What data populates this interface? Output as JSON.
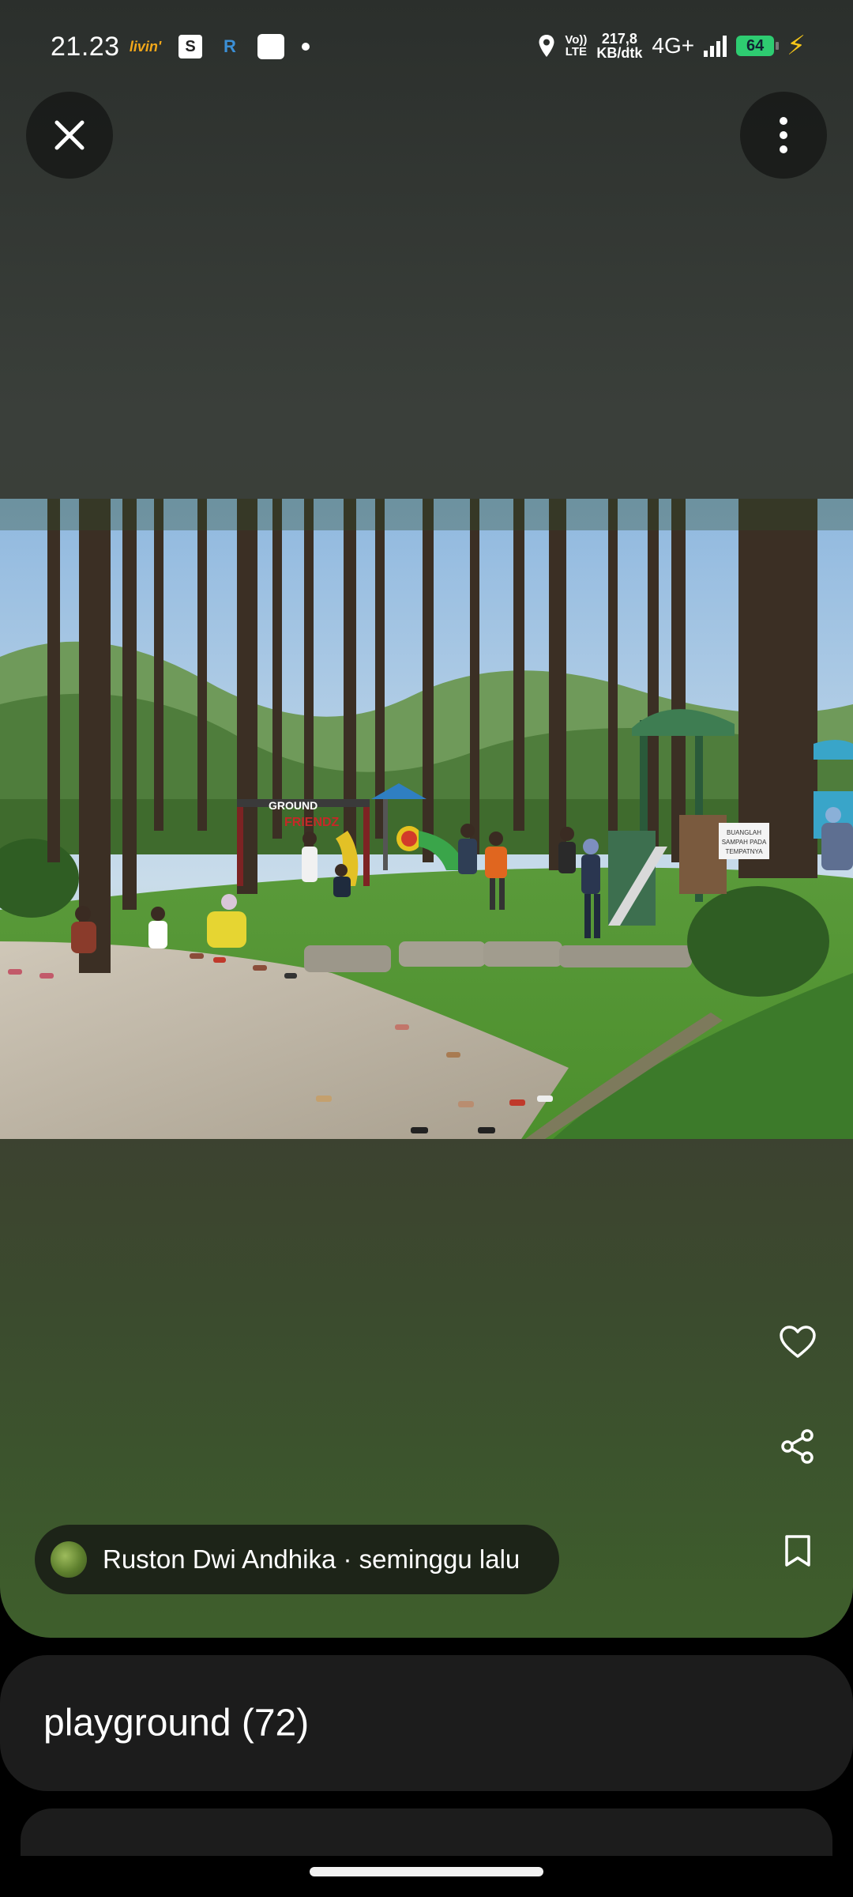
{
  "status_bar": {
    "time": "21.23",
    "app_livin": "livin'",
    "volte_top": "Vo))",
    "volte_bottom": "LTE",
    "speed_top": "217,8",
    "speed_bottom": "KB/dtk",
    "network": "4G+",
    "battery": "64"
  },
  "viewer": {
    "photo_credit": {
      "author": "Ruston Dwi Andhika · seminggu lalu"
    },
    "photo_signs": {
      "playground_sign_top": "GROUND",
      "playground_sign_bottom": "FRIENDZ",
      "notice_line1": "BUANGLAH",
      "notice_line2": "SAMPAH PADA",
      "notice_line3": "TEMPATNYA"
    }
  },
  "category": {
    "title": "playground (72)"
  }
}
